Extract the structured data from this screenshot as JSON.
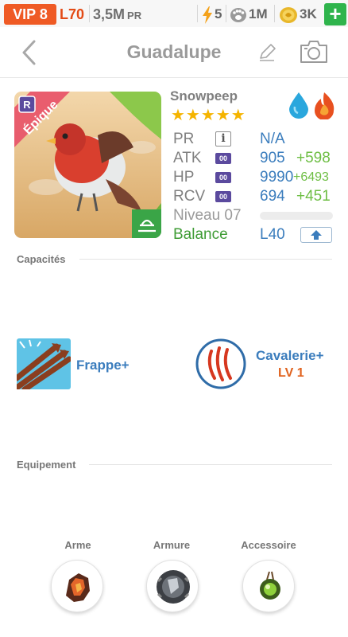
{
  "status_bar": {
    "vip": "VIP 8",
    "level": "L70",
    "power": "3,5M",
    "power_unit": "PR",
    "energy": "5",
    "food": "1M",
    "coins": "3K",
    "add_label": "+"
  },
  "header": {
    "title": "Guadalupe"
  },
  "creature": {
    "species": "Snowpeep",
    "stars": "★★★★★",
    "rarity": "Épique",
    "rarity_letter": "R",
    "elements": [
      "water-drop-icon",
      "fire-icon"
    ],
    "colors": {
      "rarity_banner": "#e8566a",
      "water": "#2aa7dd",
      "fire": "#e8501f"
    }
  },
  "stats": {
    "pr": {
      "label": "PR",
      "value": "N/A"
    },
    "atk": {
      "label": "ATK",
      "badge": "00",
      "value": "905",
      "bonus": "+598"
    },
    "hp": {
      "label": "HP",
      "badge": "00",
      "value": "9990",
      "bonus": "+6493"
    },
    "rcv": {
      "label": "RCV",
      "badge": "00",
      "value": "694",
      "bonus": "+451"
    },
    "niveau": {
      "label": "Niveau 07"
    },
    "balance": {
      "label": "Balance",
      "value": "L40"
    }
  },
  "abilities": {
    "title": "Capacités",
    "skills": [
      {
        "name": "Frappe+"
      },
      {
        "name": "Cavalerie+",
        "level": "LV 1"
      }
    ]
  },
  "equipment": {
    "title": "Equipement",
    "slots": [
      {
        "label": "Arme"
      },
      {
        "label": "Armure"
      },
      {
        "label": "Accessoire"
      }
    ]
  }
}
